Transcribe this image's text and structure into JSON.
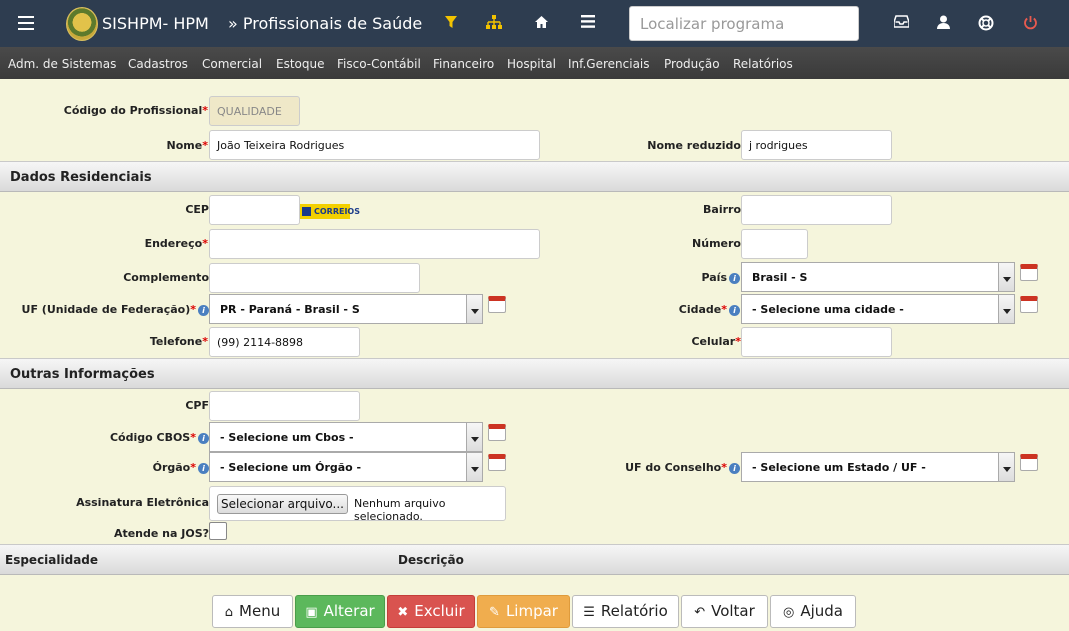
{
  "header": {
    "app_title": "SISHPM- HPM",
    "page_title": "» Profissionais de Saúde",
    "search_placeholder": "Localizar programa"
  },
  "menu": [
    "Adm. de Sistemas",
    "Cadastros",
    "Comercial",
    "Estoque",
    "Fisco-Contábil",
    "Financeiro",
    "Hospital",
    "Inf.Gerenciais",
    "Produção",
    "Relatórios"
  ],
  "form": {
    "codigo_label": "Código do Profissional",
    "codigo_value": "QUALIDADE",
    "nome_label": "Nome",
    "nome_value": "João Teixeira Rodrigues",
    "nome_reduzido_label": "Nome reduzido",
    "nome_reduzido_value": "j rodrigues"
  },
  "residencial": {
    "section_title": "Dados Residenciais",
    "cep_label": "CEP",
    "correios_label": "CORREIOS",
    "bairro_label": "Bairro",
    "endereco_label": "Endereço",
    "numero_label": "Número",
    "complemento_label": "Complemento",
    "pais_label": "País",
    "pais_value": "Brasil - S",
    "uf_label": "UF (Unidade de Federação)",
    "uf_value": "PR - Paraná - Brasil - S",
    "cidade_label": "Cidade",
    "cidade_value": "- Selecione uma cidade -",
    "telefone_label": "Telefone",
    "telefone_value": "(99) 2114-8898",
    "celular_label": "Celular"
  },
  "outras": {
    "section_title": "Outras Informações",
    "cpf_label": "CPF",
    "cbos_label": "Código CBOS",
    "cbos_value": "- Selecione um Cbos -",
    "orgao_label": "Órgão",
    "orgao_value": "- Selecione um Órgão -",
    "uf_conselho_label": "UF do Conselho",
    "uf_conselho_value": "- Selecione um Estado / UF -",
    "assinatura_label": "Assinatura Eletrônica",
    "file_button": "Selecionar arquivo...",
    "file_status": "Nenhum arquivo selecionado.",
    "jos_label": "Atende na JOS?"
  },
  "table": {
    "col_especialidade": "Especialidade",
    "col_descricao": "Descrição"
  },
  "buttons": {
    "menu": "Menu",
    "alterar": "Alterar",
    "excluir": "Excluir",
    "limpar": "Limpar",
    "relatorio": "Relatório",
    "voltar": "Voltar",
    "ajuda": "Ajuda"
  },
  "colors": {
    "topbar": "#2e3d50",
    "background": "#f5f5dc",
    "alterar": "#5cb85c",
    "excluir": "#d9534f",
    "limpar": "#f0ad4e"
  }
}
